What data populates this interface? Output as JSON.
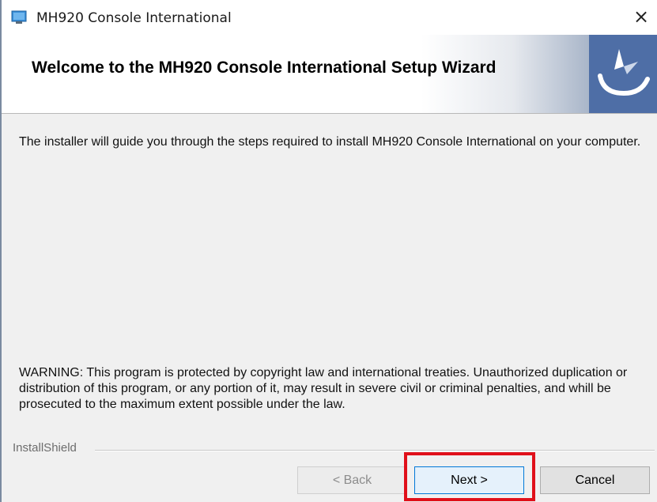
{
  "window": {
    "title": "MH920 Console International",
    "close_label": "×"
  },
  "banner": {
    "title": "Welcome to the MH920 Console International Setup Wizard"
  },
  "content": {
    "intro": "The installer will guide you through the steps required to install MH920 Console International on your computer.",
    "warning": "WARNING: This program is protected by copyright law and international treaties. Unauthorized duplication or distribution of this program, or any portion of it, may result in severe civil or criminal penalties, and whill be prosecuted to the maximum extent possible under the law."
  },
  "footer": {
    "brand": "InstallShield",
    "back_label": "< Back",
    "next_label": "Next >",
    "cancel_label": "Cancel"
  },
  "icons": {
    "app": "installer-app-icon",
    "close": "close-icon",
    "logo": "installshield-logo-icon"
  },
  "colors": {
    "highlight": "#e0101a",
    "banner_accent": "#4e6ea6",
    "focus_border": "#0078d7"
  }
}
